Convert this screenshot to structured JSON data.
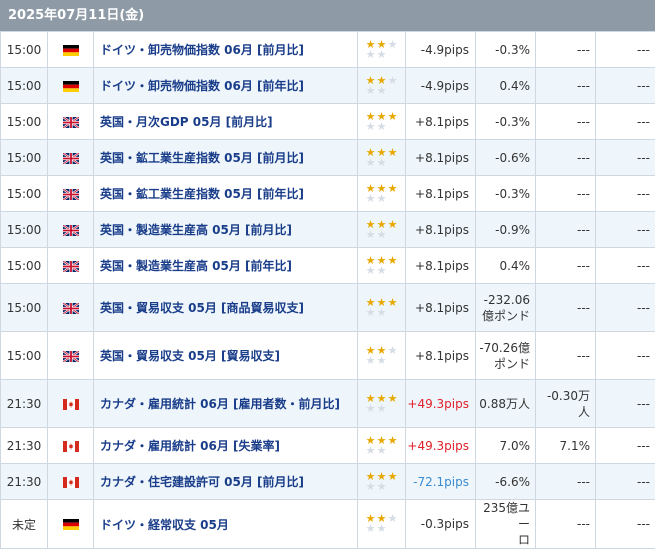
{
  "date_header": "2025年07月11日(金)",
  "rows": [
    {
      "time": "15:00",
      "country": "de",
      "flag_icon": "germany-flag-icon",
      "title": "ドイツ・卸売物価指数 06月 [前月比]",
      "stars": 2,
      "pips": "-4.9pips",
      "pips_dir": "",
      "prev": "-0.3%",
      "forecast": "---",
      "result": "---"
    },
    {
      "time": "15:00",
      "country": "de",
      "flag_icon": "germany-flag-icon",
      "title": "ドイツ・卸売物価指数 06月 [前年比]",
      "stars": 2,
      "pips": "-4.9pips",
      "pips_dir": "",
      "prev": "0.4%",
      "forecast": "---",
      "result": "---"
    },
    {
      "time": "15:00",
      "country": "uk",
      "flag_icon": "uk-flag-icon",
      "title": "英国・月次GDP 05月 [前月比]",
      "stars": 3,
      "pips": "+8.1pips",
      "pips_dir": "",
      "prev": "-0.3%",
      "forecast": "---",
      "result": "---"
    },
    {
      "time": "15:00",
      "country": "uk",
      "flag_icon": "uk-flag-icon",
      "title": "英国・鉱工業生産指数 05月 [前月比]",
      "stars": 3,
      "pips": "+8.1pips",
      "pips_dir": "",
      "prev": "-0.6%",
      "forecast": "---",
      "result": "---"
    },
    {
      "time": "15:00",
      "country": "uk",
      "flag_icon": "uk-flag-icon",
      "title": "英国・鉱工業生産指数 05月 [前年比]",
      "stars": 3,
      "pips": "+8.1pips",
      "pips_dir": "",
      "prev": "-0.3%",
      "forecast": "---",
      "result": "---"
    },
    {
      "time": "15:00",
      "country": "uk",
      "flag_icon": "uk-flag-icon",
      "title": "英国・製造業生産高 05月 [前月比]",
      "stars": 3,
      "pips": "+8.1pips",
      "pips_dir": "",
      "prev": "-0.9%",
      "forecast": "---",
      "result": "---"
    },
    {
      "time": "15:00",
      "country": "uk",
      "flag_icon": "uk-flag-icon",
      "title": "英国・製造業生産高 05月 [前年比]",
      "stars": 3,
      "pips": "+8.1pips",
      "pips_dir": "",
      "prev": "0.4%",
      "forecast": "---",
      "result": "---"
    },
    {
      "time": "15:00",
      "country": "uk",
      "flag_icon": "uk-flag-icon",
      "title": "英国・貿易収支 05月 [商品貿易収支]",
      "stars": 3,
      "pips": "+8.1pips",
      "pips_dir": "",
      "prev": "-232.06\n億ポンド",
      "forecast": "---",
      "result": "---"
    },
    {
      "time": "15:00",
      "country": "uk",
      "flag_icon": "uk-flag-icon",
      "title": "英国・貿易収支 05月 [貿易収支]",
      "stars": 2,
      "pips": "+8.1pips",
      "pips_dir": "",
      "prev": "-70.26億\nポンド",
      "forecast": "---",
      "result": "---"
    },
    {
      "time": "21:30",
      "country": "ca",
      "flag_icon": "canada-flag-icon",
      "title": "カナダ・雇用統計 06月 [雇用者数・前月比]",
      "stars": 3,
      "pips": "+49.3pips",
      "pips_dir": "pos",
      "prev": "0.88万人",
      "forecast": "-0.30万\n人",
      "result": "---"
    },
    {
      "time": "21:30",
      "country": "ca",
      "flag_icon": "canada-flag-icon",
      "title": "カナダ・雇用統計 06月 [失業率]",
      "stars": 3,
      "pips": "+49.3pips",
      "pips_dir": "pos",
      "prev": "7.0%",
      "forecast": "7.1%",
      "result": "---"
    },
    {
      "time": "21:30",
      "country": "ca",
      "flag_icon": "canada-flag-icon",
      "title": "カナダ・住宅建設許可 05月 [前月比]",
      "stars": 3,
      "pips": "-72.1pips",
      "pips_dir": "neg",
      "prev": "-6.6%",
      "forecast": "---",
      "result": "---"
    },
    {
      "time": "未定",
      "country": "de",
      "flag_icon": "germany-flag-icon",
      "title": "ドイツ・経常収支 05月",
      "stars": 2,
      "pips": "-0.3pips",
      "pips_dir": "",
      "prev": "235億ユー\nロ",
      "forecast": "---",
      "result": "---"
    }
  ]
}
